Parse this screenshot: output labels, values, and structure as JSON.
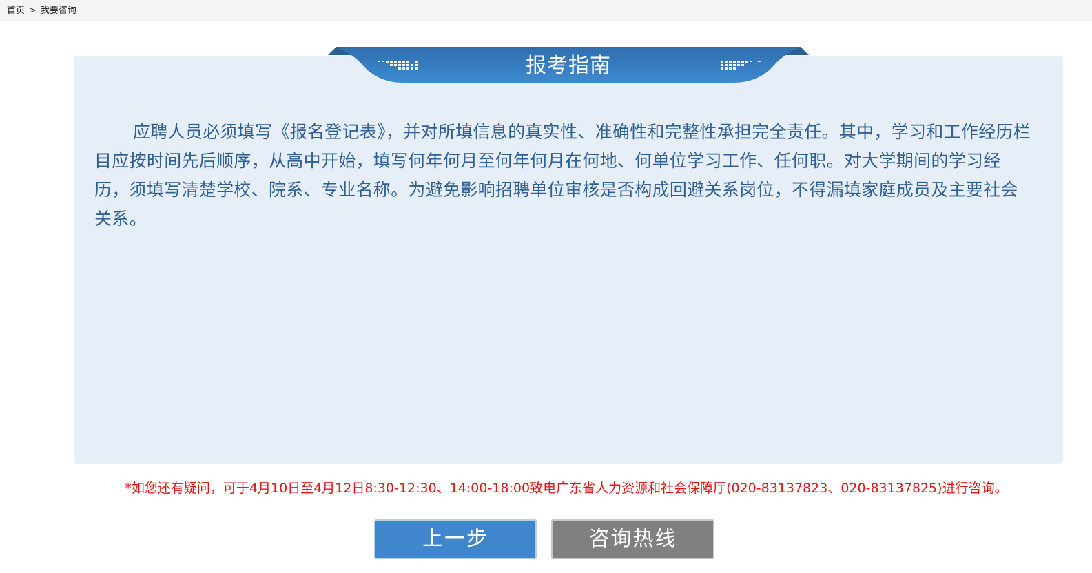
{
  "breadcrumb": {
    "home": "首页",
    "separator": ">",
    "current": "我要咨询"
  },
  "panel": {
    "title": "报考指南",
    "body": "应聘人员必须填写《报名登记表》，并对所填信息的真实性、准确性和完整性承担完全责任。其中，学习和工作经历栏目应按时间先后顺序，从高中开始，填写何年何月至何年何月在何地、何单位学习工作、任何职。对大学期间的学习经历，须填写清楚学校、院系、专业名称。为避免影响招聘单位审核是否构成回避关系岗位，不得漏填家庭成员及主要社会关系。"
  },
  "notice": "*如您还有疑问，可于4月10日至4月12日8:30-12:30、14:00-18:00致电广东省人力资源和社会保障厅(020-83137823、020-83137825)进行咨询。",
  "buttons": {
    "prev": "上一步",
    "hotline": "咨询热线"
  },
  "colors": {
    "banner_blue": "#3a84c8",
    "panel_bg": "#e6eef8",
    "text_blue": "#2f5f93",
    "notice_red": "#e31515",
    "prev_button": "#3f86cc",
    "hotline_button": "#808080"
  }
}
